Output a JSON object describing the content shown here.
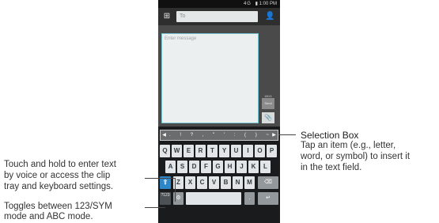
{
  "status_bar": {
    "signal": "4G",
    "time": "1:00 PM"
  },
  "header": {
    "to_placeholder": "To"
  },
  "message": {
    "placeholder": "Enter message",
    "counter": "160/1",
    "send_label": "Send"
  },
  "selection_bar": {
    "items": [
      ".",
      "!",
      "?",
      ",",
      "\"",
      "'",
      ":",
      "(",
      ")",
      "~"
    ]
  },
  "keyboard": {
    "row1": [
      "Q",
      "W",
      "E",
      "R",
      "T",
      "Y",
      "U",
      "I",
      "O",
      "P"
    ],
    "row2": [
      "A",
      "S",
      "D",
      "F",
      "G",
      "H",
      "J",
      "K",
      "L"
    ],
    "row3": [
      "Z",
      "X",
      "C",
      "V",
      "B",
      "N",
      "M"
    ],
    "sym_key_label": "?123"
  },
  "annotations": {
    "selection_box_title": "Selection Box",
    "selection_box_desc": [
      "Tap an item (e.g., letter,",
      "word, or symbol) to insert it",
      "in the text field."
    ],
    "touch_hold": [
      "Touch and hold to enter text",
      "by voice or access the clip",
      "tray and keyboard settings."
    ],
    "toggles": [
      "Toggles between 123/SYM",
      "mode and ABC mode."
    ]
  }
}
